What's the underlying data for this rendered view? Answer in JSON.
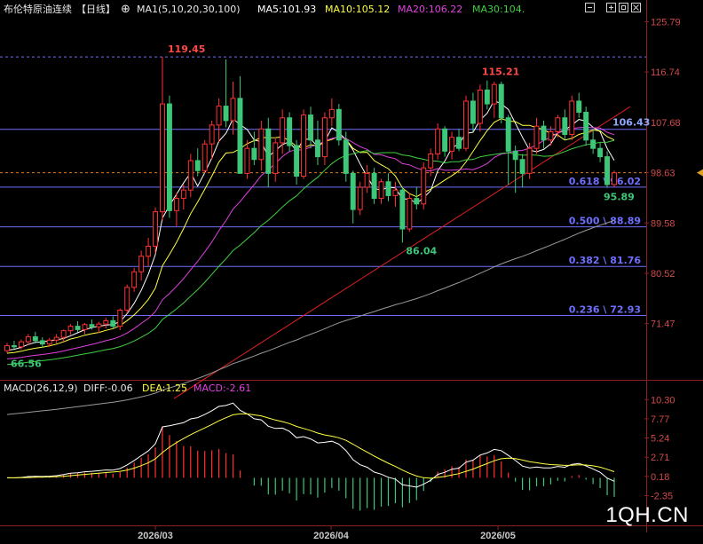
{
  "header": {
    "title": "布伦特原油连续",
    "period": "【日线】",
    "indicator": "MA1(5,10,20,30,100)",
    "ma5": "MA5:101.93",
    "ma10": "MA10:105.12",
    "ma20": "MA20:106.22",
    "ma30": "MA30:104."
  },
  "macd_header": {
    "name": "MACD(26,12,9)",
    "diff": "DIFF:-0.06",
    "dea": "DEA:1.25",
    "macd": "MACD:-2.61"
  },
  "watermark": "1QH.CN",
  "colors": {
    "up": "#ff3232",
    "down": "#3cc878",
    "ma5": "#ffffff",
    "ma10": "#ffff40",
    "ma20": "#e040e0",
    "ma30": "#40d040",
    "ma100": "#9a9a9a",
    "fib": "#6f6fff",
    "trend": "#e02020",
    "axis_text": "#d04a4a"
  },
  "chart_data": [
    {
      "type": "candlestick",
      "title": "布伦特原油连续 【日线】",
      "y_ticks": [
        "125.79",
        "116.74",
        "107.68",
        "98.63",
        "89.58",
        "80.52",
        "71.47"
      ],
      "ylim": [
        62.0,
        126.5
      ],
      "x_ticks": [
        "2026/03",
        "2026/04",
        "2026/05"
      ],
      "current_price": "98.63",
      "fib_levels": [
        {
          "ratio": "",
          "label": "",
          "value": 119.45
        },
        {
          "ratio": "",
          "label": "",
          "value": 106.43
        },
        {
          "ratio": "0.618",
          "label": "96.02",
          "value": 96.02
        },
        {
          "ratio": "0.500",
          "label": "88.89",
          "value": 88.89
        },
        {
          "ratio": "0.382",
          "label": "81.76",
          "value": 81.76
        },
        {
          "ratio": "0.236",
          "label": "72.93",
          "value": 72.93
        }
      ],
      "annotations": {
        "high_label": "119.45",
        "high2_label": "115.21",
        "low_label": "86.04",
        "start_label": "66.56",
        "ma_value_label": "106.43",
        "last_low_label": "95.89"
      },
      "ohlc": [
        [
          66.6,
          68.0,
          66.2,
          67.5
        ],
        [
          67.5,
          68.4,
          66.9,
          67.3
        ],
        [
          67.3,
          68.6,
          66.8,
          68.2
        ],
        [
          68.2,
          69.6,
          67.6,
          69.1
        ],
        [
          69.1,
          70.0,
          67.9,
          68.4
        ],
        [
          68.4,
          69.0,
          67.1,
          67.8
        ],
        [
          67.8,
          68.9,
          67.3,
          68.5
        ],
        [
          68.5,
          69.6,
          67.9,
          69.0
        ],
        [
          69.0,
          70.4,
          68.2,
          70.2
        ],
        [
          70.2,
          71.4,
          69.5,
          71.0
        ],
        [
          71.0,
          71.9,
          69.9,
          70.4
        ],
        [
          70.4,
          71.6,
          69.6,
          71.3
        ],
        [
          71.3,
          72.2,
          70.4,
          70.9
        ],
        [
          70.9,
          71.8,
          69.8,
          71.4
        ],
        [
          71.4,
          72.5,
          70.6,
          72.0
        ],
        [
          72.0,
          72.8,
          70.6,
          71.0
        ],
        [
          71.0,
          74.2,
          70.3,
          73.9
        ],
        [
          73.9,
          78.5,
          73.3,
          78.0
        ],
        [
          78.0,
          81.5,
          77.2,
          80.8
        ],
        [
          80.8,
          84.6,
          79.2,
          83.6
        ],
        [
          83.6,
          86.9,
          81.8,
          85.4
        ],
        [
          85.4,
          92.4,
          84.1,
          91.6
        ],
        [
          91.6,
          119.45,
          90.0,
          111.0
        ],
        [
          111.0,
          112.5,
          90.5,
          91.8
        ],
        [
          91.8,
          95.0,
          89.0,
          94.0
        ],
        [
          94.0,
          96.5,
          92.0,
          95.5
        ],
        [
          95.5,
          102.0,
          94.2,
          100.8
        ],
        [
          100.8,
          103.0,
          98.0,
          99.0
        ],
        [
          99.0,
          104.5,
          98.5,
          103.8
        ],
        [
          103.8,
          108.0,
          101.0,
          107.2
        ],
        [
          107.2,
          112.0,
          104.2,
          110.6
        ],
        [
          110.6,
          119.0,
          106.8,
          108.0
        ],
        [
          108.0,
          115.0,
          105.5,
          112.0
        ],
        [
          112.0,
          116.0,
          103.0,
          98.5
        ],
        [
          98.5,
          104.5,
          97.5,
          103.0
        ],
        [
          103.0,
          106.0,
          100.0,
          101.0
        ],
        [
          101.0,
          108.0,
          99.0,
          106.5
        ],
        [
          106.5,
          108.5,
          96.0,
          98.5
        ],
        [
          98.5,
          105.0,
          97.0,
          104.0
        ],
        [
          104.0,
          110.0,
          102.0,
          108.5
        ],
        [
          108.5,
          109.5,
          102.5,
          103.5
        ],
        [
          103.5,
          104.5,
          96.5,
          98.0
        ],
        [
          98.0,
          110.0,
          97.5,
          109.0
        ],
        [
          109.0,
          110.5,
          103.0,
          104.5
        ],
        [
          104.5,
          108.0,
          100.0,
          101.5
        ],
        [
          101.5,
          109.5,
          100.0,
          108.5
        ],
        [
          108.5,
          112.0,
          107.0,
          110.0
        ],
        [
          110.0,
          111.0,
          103.5,
          104.5
        ],
        [
          104.5,
          106.0,
          97.0,
          98.5
        ],
        [
          98.5,
          99.0,
          89.5,
          92.0
        ],
        [
          92.0,
          97.0,
          91.0,
          96.0
        ],
        [
          96.0,
          100.0,
          95.0,
          98.5
        ],
        [
          98.5,
          99.5,
          93.0,
          94.0
        ],
        [
          94.0,
          97.5,
          93.0,
          97.0
        ],
        [
          97.0,
          98.5,
          93.5,
          94.5
        ],
        [
          94.5,
          97.0,
          92.5,
          95.5
        ],
        [
          95.5,
          96.0,
          86.04,
          88.5
        ],
        [
          88.5,
          95.0,
          88.0,
          94.0
        ],
        [
          94.0,
          96.0,
          92.0,
          93.0
        ],
        [
          93.0,
          100.5,
          92.0,
          99.5
        ],
        [
          99.5,
          103.0,
          98.0,
          102.0
        ],
        [
          102.0,
          107.5,
          101.0,
          106.5
        ],
        [
          106.5,
          107.0,
          101.5,
          102.5
        ],
        [
          102.5,
          106.0,
          101.0,
          105.0
        ],
        [
          105.0,
          106.5,
          102.5,
          103.0
        ],
        [
          103.0,
          112.5,
          102.5,
          111.5
        ],
        [
          111.5,
          113.0,
          106.0,
          107.5
        ],
        [
          107.5,
          114.5,
          106.0,
          113.5
        ],
        [
          113.5,
          115.21,
          110.0,
          111.0
        ],
        [
          111.0,
          115.0,
          108.5,
          114.5
        ],
        [
          114.5,
          115.0,
          107.5,
          108.5
        ],
        [
          108.5,
          109.0,
          96.5,
          102.5
        ],
        [
          102.5,
          103.5,
          95.0,
          101.0
        ],
        [
          101.0,
          102.0,
          96.0,
          98.5
        ],
        [
          98.5,
          104.0,
          97.5,
          103.0
        ],
        [
          103.0,
          108.5,
          102.0,
          107.0
        ],
        [
          107.0,
          108.0,
          103.0,
          104.5
        ],
        [
          104.5,
          107.0,
          103.5,
          106.0
        ],
        [
          106.0,
          109.0,
          105.0,
          108.5
        ],
        [
          108.5,
          110.0,
          104.5,
          105.5
        ],
        [
          105.5,
          112.5,
          104.5,
          111.5
        ],
        [
          111.5,
          113.0,
          108.5,
          109.5
        ],
        [
          109.5,
          110.5,
          103.5,
          104.5
        ],
        [
          104.5,
          106.5,
          102.0,
          103.0
        ],
        [
          103.0,
          104.0,
          100.5,
          101.5
        ],
        [
          101.5,
          102.5,
          95.89,
          96.5
        ],
        [
          96.5,
          99.0,
          96.0,
          98.6
        ]
      ],
      "ma_series": [
        {
          "name": "MA5",
          "color": "#ffffff"
        },
        {
          "name": "MA10",
          "color": "#ffff40"
        },
        {
          "name": "MA20",
          "color": "#e040e0"
        },
        {
          "name": "MA30",
          "color": "#40d040"
        },
        {
          "name": "MA100",
          "color": "#9a9a9a"
        }
      ],
      "trendline": [
        {
          "bar": 1,
          "value": 58.0
        },
        {
          "bar": 87,
          "value": 110.5
        }
      ]
    },
    {
      "type": "bar",
      "title": "MACD(26,12,9)",
      "y_ticks": [
        "10.30",
        "7.77",
        "5.24",
        "2.71",
        "0.18",
        "-2.35"
      ],
      "ylim": [
        -6.5,
        10.8
      ],
      "series_names": [
        "DIFF",
        "DEA",
        "MACD"
      ]
    }
  ]
}
